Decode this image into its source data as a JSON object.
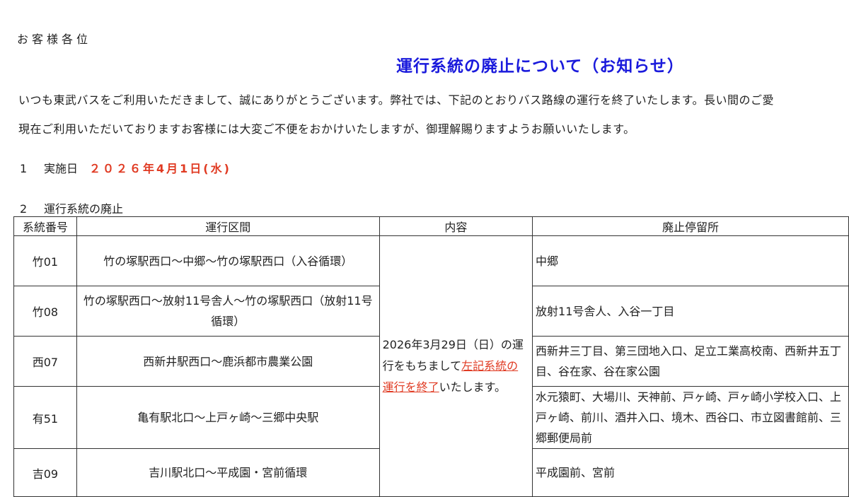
{
  "greeting": "お客様各位",
  "title": "運行系統の廃止について（お知らせ）",
  "intro_line1": "いつも東武バスをご利用いただきまして、誠にありがとうございます。弊社では、下記のとおりバス路線の運行を終了いたします。長い間のご愛",
  "intro_line2": "現在ご利用いただいておりますお客様には大変ご不便をおかけいたしますが、御理解賜りますようお願いいたします。",
  "section1": {
    "number": "1",
    "label": "実施日",
    "date": "２０２６年4月1日(水)"
  },
  "section2": {
    "number": "2",
    "label": "運行系統の廃止"
  },
  "table": {
    "headers": {
      "code": "系統番号",
      "route": "運行区間",
      "content": "内容",
      "stops": "廃止停留所"
    },
    "content_text": {
      "before": "2026年3月29日（日）の運行をもちまして",
      "highlight": "左記系統の運行を終了",
      "after": "いたします。"
    },
    "rows": [
      {
        "code": "竹01",
        "route": "竹の塚駅西口～中郷～竹の塚駅西口（入谷循環）",
        "stops": "中郷"
      },
      {
        "code": "竹08",
        "route": "竹の塚駅西口～放射11号舎人～竹の塚駅西口（放射11号循環）",
        "stops": "放射11号舎人、入谷一丁目"
      },
      {
        "code": "西07",
        "route": "西新井駅西口～鹿浜都市農業公園",
        "stops": "西新井三丁目、第三団地入口、足立工業高校南、西新井五丁目、谷在家、谷在家公園"
      },
      {
        "code": "有51",
        "route": "亀有駅北口～上戸ヶ崎～三郷中央駅",
        "stops": "水元猿町、大場川、天神前、戸ヶ崎、戸ヶ崎小学校入口、上戸ヶ崎、前川、酒井入口、境木、西谷口、市立図書館前、三郷郵便局前"
      },
      {
        "code": "吉09",
        "route": "吉川駅北口～平成園・宮前循環",
        "stops": "平成園前、宮前"
      }
    ]
  }
}
